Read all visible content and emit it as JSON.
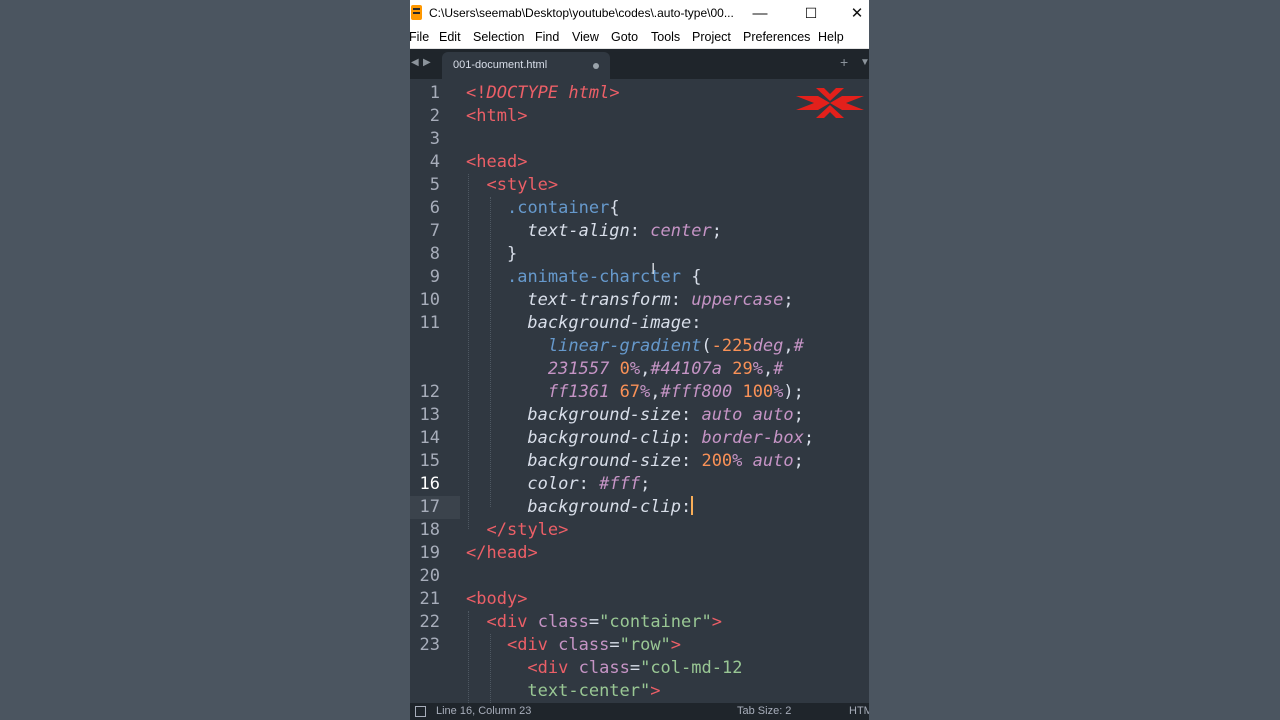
{
  "window": {
    "title": "C:\\Users\\seemab\\Desktop\\youtube\\codes\\.auto-type\\00..."
  },
  "titlebar_buttons": {
    "minimize": "—",
    "maximize": "☐",
    "close": "✕"
  },
  "menu": [
    "File",
    "Edit",
    "Selection",
    "Find",
    "View",
    "Goto",
    "Tools",
    "Project",
    "Preferences",
    "Help"
  ],
  "tabs": {
    "nav_left": "◀",
    "nav_right": "▶",
    "active": "001-document.html",
    "new_tab": "+",
    "overflow": "▼"
  },
  "gutter": [
    {
      "n": "1",
      "row": 0
    },
    {
      "n": "2",
      "row": 1
    },
    {
      "n": "3",
      "row": 2
    },
    {
      "n": "4",
      "row": 3
    },
    {
      "n": "5",
      "row": 4
    },
    {
      "n": "6",
      "row": 5
    },
    {
      "n": "7",
      "row": 6
    },
    {
      "n": "8",
      "row": 7
    },
    {
      "n": "9",
      "row": 8
    },
    {
      "n": "10",
      "row": 9
    },
    {
      "n": "11",
      "row": 10
    },
    {
      "n": "12",
      "row": 13
    },
    {
      "n": "13",
      "row": 14
    },
    {
      "n": "14",
      "row": 15
    },
    {
      "n": "15",
      "row": 16
    },
    {
      "n": "16",
      "row": 17
    },
    {
      "n": "17",
      "row": 18
    },
    {
      "n": "18",
      "row": 19
    },
    {
      "n": "19",
      "row": 20
    },
    {
      "n": "20",
      "row": 21
    },
    {
      "n": "21",
      "row": 22
    },
    {
      "n": "22",
      "row": 23
    },
    {
      "n": "23",
      "row": 24
    }
  ],
  "current_line": "16",
  "code": {
    "l1": {
      "lt": "<",
      "bang": "!",
      "doctype": "DOCTYPE",
      "html": "html",
      "gt": ">"
    },
    "l2": {
      "lt": "<",
      "tag": "html",
      "gt": ">"
    },
    "l4": {
      "lt": "<",
      "tag": "head",
      "gt": ">"
    },
    "l5": {
      "lt": "<",
      "tag": "style",
      "gt": ">"
    },
    "l6": {
      "dot": ".",
      "cls": "container",
      "brace": "{"
    },
    "l7": {
      "prop": "text-align",
      "colon": ":",
      "val": "center",
      "semi": ";"
    },
    "l8": {
      "brace": "}"
    },
    "l9": {
      "dot": ".",
      "cls": "animate-charcter",
      "brace": "{"
    },
    "l10": {
      "prop": "text-transform",
      "colon": ":",
      "val": "uppercase",
      "semi": ";"
    },
    "l11": {
      "prop": "background-image",
      "colon": ":"
    },
    "l11a": {
      "fn": "linear-gradient",
      "paren": "(",
      "num1": "-225",
      "unit1": "deg",
      "comma1": ",",
      "hash1": "#"
    },
    "l11b": {
      "hex1": "231557",
      "num2": "0",
      "pct2": "%",
      "comma2": ",",
      "hex2": "#44107a",
      "num3": "29",
      "pct3": "%",
      "comma3": ",",
      "hash3": "#"
    },
    "l11c": {
      "hex3": "ff1361",
      "num4": "67",
      "pct4": "%",
      "comma4": ",",
      "hex4": "#fff800",
      "num5": "100",
      "pct5": "%",
      "close": ");"
    },
    "l12": {
      "prop": "background-size",
      "colon": ":",
      "val": "auto auto",
      "semi": ";"
    },
    "l13": {
      "prop": "background-clip",
      "colon": ":",
      "val": "border-box",
      "semi": ";"
    },
    "l14": {
      "prop": "background-size",
      "colon": ":",
      "num": "200",
      "pct": "%",
      "val": "auto",
      "semi": ";"
    },
    "l15": {
      "prop": "color",
      "colon": ":",
      "val": "#fff",
      "semi": ";"
    },
    "l16": {
      "prop": "background-clip",
      "colon": ":"
    },
    "l17": {
      "lt": "</",
      "tag": "style",
      "gt": ">"
    },
    "l18": {
      "lt": "</",
      "tag": "head",
      "gt": ">"
    },
    "l20": {
      "lt": "<",
      "tag": "body",
      "gt": ">"
    },
    "l21": {
      "lt": "<",
      "tag": "div",
      "attr": "class",
      "eq": "=",
      "val": "\"container\"",
      "gt": ">"
    },
    "l22": {
      "lt": "<",
      "tag": "div",
      "attr": "class",
      "eq": "=",
      "val": "\"row\"",
      "gt": ">"
    },
    "l23": {
      "lt": "<",
      "tag": "div",
      "attr": "class",
      "eq": "=",
      "val": "\"col-md-12"
    },
    "l23a": {
      "val": "text-center\"",
      "gt": ">"
    }
  },
  "status": {
    "position": "Line 16, Column 23",
    "tab_size": "Tab Size: 2",
    "syntax": "HTML"
  },
  "colors": {
    "editor_bg": "#303841",
    "tag": "#ec5f67",
    "attribute": "#c594c5",
    "string": "#99c794",
    "number": "#f99157",
    "function": "#6699cc",
    "caret": "#f9ae58"
  },
  "icons": {
    "app": "sublime-text-icon",
    "logo": "red-x-logo-icon"
  }
}
